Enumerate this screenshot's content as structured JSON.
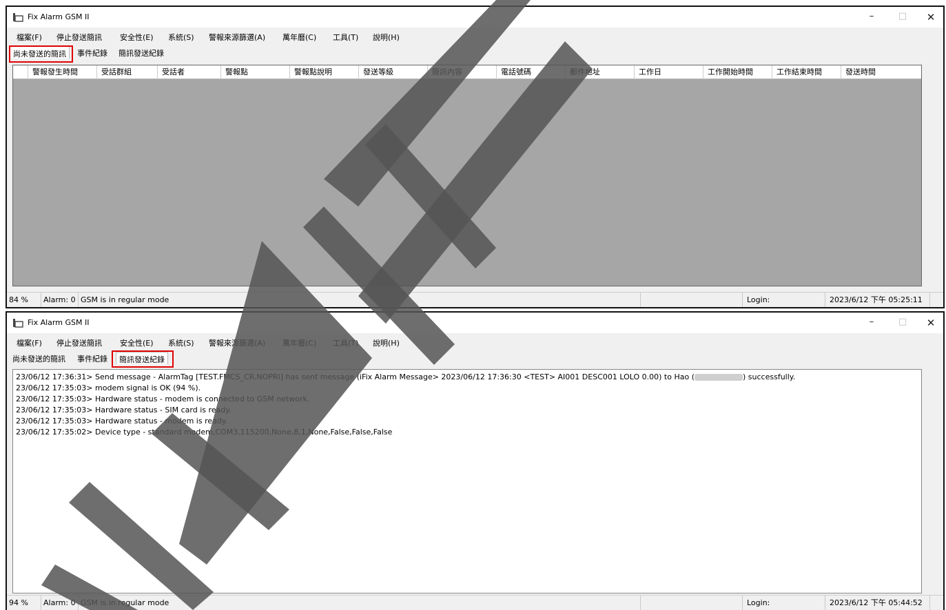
{
  "window1": {
    "title": "Fix Alarm GSM II",
    "min": "–",
    "max": "□",
    "close": "✕",
    "menus": [
      "檔案(F)",
      "停止發送簡訊",
      "安全性(E)",
      "系統(S)",
      "警報來源篩選(A)",
      "萬年曆(C)",
      "工具(T)",
      "說明(H)"
    ],
    "tabs": [
      "尚未發送的簡訊",
      "事件紀錄",
      "簡訊發送紀錄"
    ],
    "active_tab": "尚未發送的簡訊",
    "columns": [
      "警報發生時間",
      "受話群組",
      "受話者",
      "警報點",
      "警報點說明",
      "發送等級",
      "簡訊內容",
      "電話號碼",
      "郵件地址",
      "工作日",
      "工作開始時間",
      "工作結束時間",
      "發送時間"
    ],
    "status": {
      "percent": "84 %",
      "alarm": "Alarm: 0",
      "mode": "GSM is in regular mode",
      "login": "Login:",
      "datetime": "2023/6/12 下午 05:25:11"
    }
  },
  "window2": {
    "title": "Fix Alarm GSM II",
    "min": "–",
    "max": "□",
    "close": "✕",
    "menus": [
      "檔案(F)",
      "停止發送簡訊",
      "安全性(E)",
      "系統(S)",
      "警報來源篩選(A)",
      "萬年曆(C)",
      "工具(T)",
      "說明(H)"
    ],
    "tabs": [
      "尚未發送的簡訊",
      "事件紀錄",
      "簡訊發送紀錄"
    ],
    "active_tab": "簡訊發送紀錄",
    "log": {
      "first_prefix": "23/06/12 17:36:31> Send message - AlarmTag [TEST.FMCS_CR.NOPRI] has sent message (iFix Alarm Message> 2023/06/12 17:36:30 <TEST> AI001 DESC001 LOLO 0.00) to Hao (",
      "first_suffix": ") successfully.",
      "lines": [
        "23/06/12 17:35:03> modem signal is OK (94 %).",
        "23/06/12 17:35:03> Hardware status - modem is connected to GSM network.",
        "23/06/12 17:35:03> Hardware status - SIM card is ready.",
        "23/06/12 17:35:03> Hardware status - modem is ready.",
        "23/06/12 17:35:02> Device type - standard modem,COM3,115200,None,8,1,None,False,False,False"
      ]
    },
    "status": {
      "percent": "94 %",
      "alarm": "Alarm: 0",
      "mode": "GSM is in regular mode",
      "login": "Login:",
      "datetime": "2023/6/12 下午 05:44:52"
    }
  },
  "colors": {
    "highlight": "#e00000",
    "table_bg": "#a6a6a6",
    "watermark": "#555555"
  }
}
